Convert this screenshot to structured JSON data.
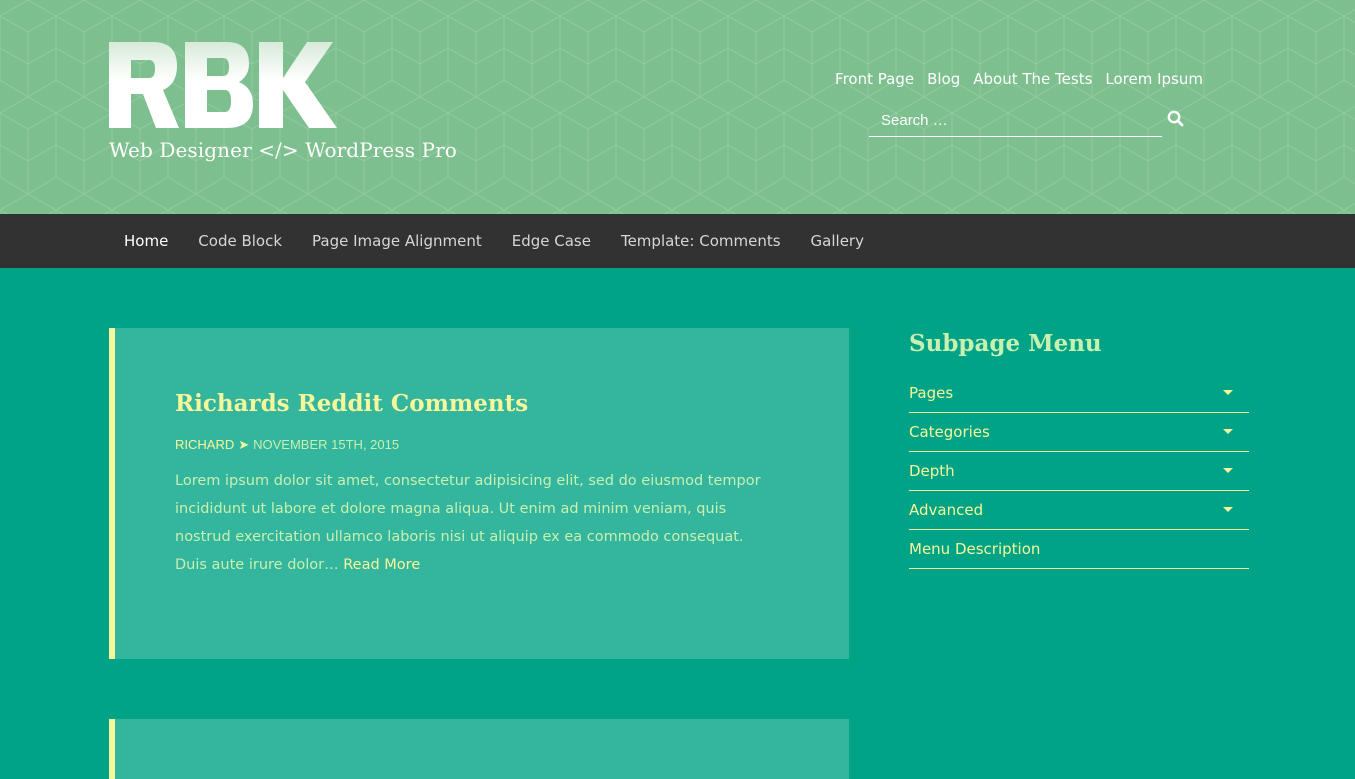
{
  "header": {
    "logo_text": "RBK",
    "tagline": "Web Designer </> WordPress Pro",
    "top_nav": [
      "Front Page",
      "Blog",
      "About The Tests",
      "Lorem Ipsum"
    ],
    "search": {
      "placeholder": "Search …"
    },
    "search_icon": "search-icon"
  },
  "main_nav": {
    "items": [
      "Home",
      "Code Block",
      "Page Image Alignment",
      "Edge Case",
      "Template: Comments",
      "Gallery"
    ],
    "active": "Home"
  },
  "post": {
    "title": "Richards Reddit Comments",
    "author": "Richard",
    "separator": "➤",
    "date": "November 15th, 2015",
    "excerpt": "Lorem ipsum dolor sit amet, consectetur adipisicing elit, sed do eiusmod tempor incididunt ut labore et dolore magna aliqua. Ut enim ad minim veniam, quis nostrud exercitation ullamco laboris nisi ut aliquip ex ea commodo consequat. Duis aute irure dolor…",
    "read_more": "Read More"
  },
  "sidebar": {
    "title": "Subpage Menu",
    "items": [
      {
        "label": "Pages",
        "has_dropdown": true
      },
      {
        "label": "Categories",
        "has_dropdown": true
      },
      {
        "label": "Depth",
        "has_dropdown": true
      },
      {
        "label": "Advanced",
        "has_dropdown": true
      },
      {
        "label": "Menu Description",
        "has_dropdown": false
      }
    ]
  },
  "colors": {
    "header_bg": "#7dbf8e",
    "page_bg": "#00a386",
    "nav_bg": "#323232",
    "card_bg": "#33b59e",
    "accent_yellow": "#f6f69b",
    "text_green": "#c8f0b0"
  }
}
